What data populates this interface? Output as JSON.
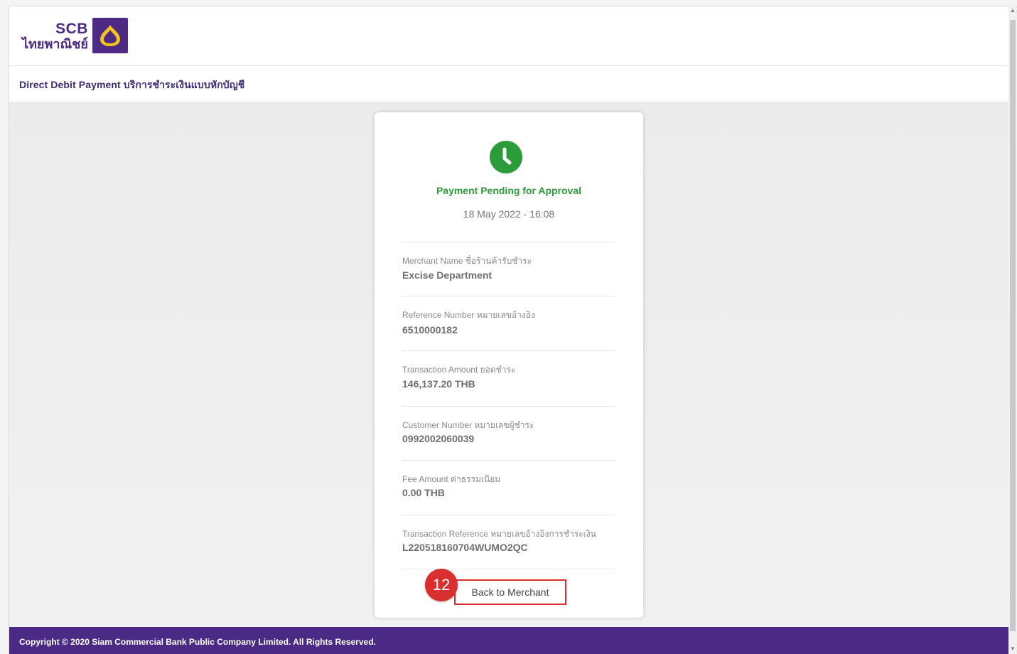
{
  "logo": {
    "brand": "SCB",
    "thai_name": "ไทยพาณิชย์"
  },
  "page": {
    "title": "Direct Debit Payment บริการชำระเงินแบบหักบัญชี"
  },
  "status": {
    "title": "Payment Pending for Approval",
    "datetime": "18 May 2022 - 16:08",
    "color": "#2a9d3a"
  },
  "details": [
    {
      "label": "Merchant Name  ชื่อร้านค้ารับชำระ",
      "value": "Excise Department"
    },
    {
      "label": "Reference Number  หมายเลขอ้างอิง",
      "value": "6510000182"
    },
    {
      "label": "Transaction Amount  ยอดชำระ",
      "value": "146,137.20 THB"
    },
    {
      "label": "Customer Number  หมายเลขผู้ชำระ",
      "value": "0992002060039"
    },
    {
      "label": "Fee Amount  ค่าธรรมเนียม",
      "value": "0.00 THB"
    },
    {
      "label": "Transaction Reference  หมายเลขอ้างอิงการชำระเงิน",
      "value": "L220518160704WUMO2QC"
    }
  ],
  "actions": {
    "back_label": "Back to Merchant",
    "step_number": "12"
  },
  "footer": {
    "copyright": "Copyright © 2020 Siam Commercial Bank Public Company Limited. All Rights Reserved."
  },
  "colors": {
    "brand_purple": "#4b2a86",
    "annotation_red": "#d9302f"
  },
  "icons": {
    "status": "clock-icon",
    "logo_mark": "scb-logo-icon"
  }
}
